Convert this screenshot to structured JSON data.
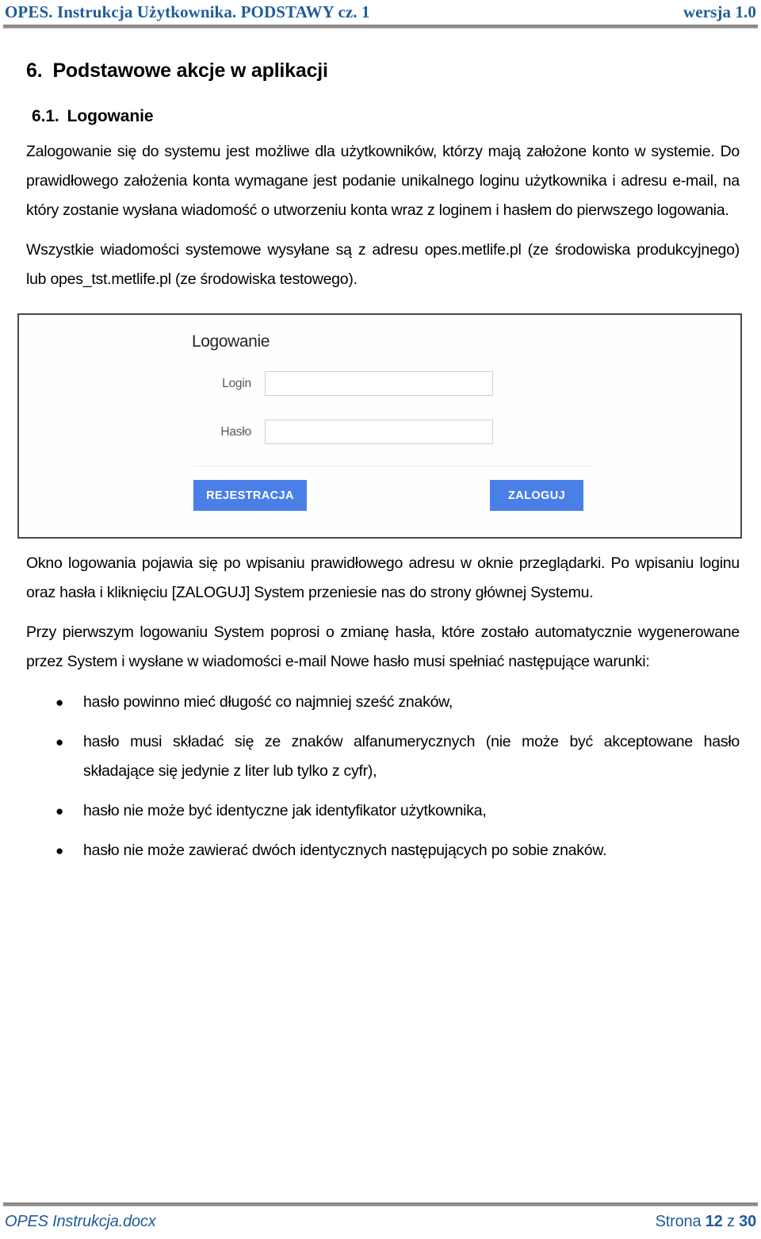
{
  "header": {
    "left": "OPES. Instrukcja Użytkownika. PODSTAWY cz. 1",
    "right": "wersja 1.0",
    "color": "#1f5c99"
  },
  "section": {
    "number": "6.",
    "title": "Podstawowe akcje w aplikacji"
  },
  "subsection": {
    "number": "6.1.",
    "title": "Logowanie"
  },
  "paragraphs": {
    "p1": "Zalogowanie się do systemu jest możliwe dla użytkowników, którzy mają założone konto w systemie. Do prawidłowego założenia konta wymagane jest podanie unikalnego loginu użytkownika i adresu e-mail, na który zostanie wysłana wiadomość o utworzeniu konta wraz z loginem i hasłem do pierwszego logowania.",
    "p2": "Wszystkie wiadomości systemowe wysyłane są z adresu opes.metlife.pl (ze środowiska produkcyjnego) lub opes_tst.metlife.pl (ze środowiska testowego).",
    "p3": "Okno logowania pojawia się po wpisaniu prawidłowego adresu w oknie przeglądarki. Po wpisaniu loginu oraz hasła i kliknięciu [ZALOGUJ] System przeniesie nas do strony głównej Systemu.",
    "p4": "Przy pierwszym logowaniu System poprosi  o zmianę hasła, które zostało automatycznie wygenerowane przez System i wysłane w wiadomości e-mail Nowe hasło musi spełniać następujące warunki:"
  },
  "login_form": {
    "title": "Logowanie",
    "fields": [
      {
        "label": "Login",
        "value": "",
        "placeholder": ""
      },
      {
        "label": "Hasło",
        "value": "",
        "placeholder": ""
      }
    ],
    "buttons": {
      "register": "REJESTRACJA",
      "login": "ZALOGUJ"
    },
    "button_color": "#4a7fe8",
    "field_border_color": "#cfcfcf",
    "frame_border_color": "#4a4a4a"
  },
  "conditions": {
    "bullet_glyph": "●",
    "items": [
      "hasło powinno mieć długość co najmniej sześć znaków,",
      "hasło musi składać się ze znaków alfanumerycznych (nie może być akceptowane hasło składające się jedynie z liter lub tylko z cyfr),",
      "hasło nie może być identyczne jak identyfikator użytkownika,",
      "hasło nie może zawierać dwóch identycznych następujących po sobie znaków."
    ]
  },
  "footer": {
    "file_name": "OPES Instrukcja.docx",
    "page_prefix": "Strona",
    "page_current": "12",
    "page_separator": "z",
    "page_total": "30"
  }
}
